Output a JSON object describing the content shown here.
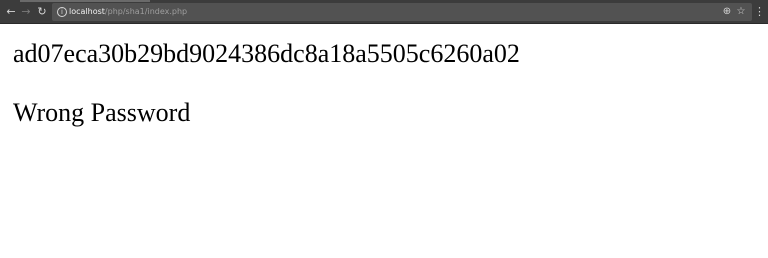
{
  "browser": {
    "icons": {
      "back": "arrow-left-icon",
      "forward": "arrow-right-icon",
      "reload": "reload-icon",
      "info": "info-icon",
      "zoom": "zoom-icon",
      "bookmark": "star-icon",
      "menu": "kebab-menu-icon"
    },
    "address_bar": {
      "host": "localhost",
      "path": "/php/sha1/index.php"
    }
  },
  "page": {
    "hash": "ad07eca30b29bd9024386dc8a18a5505c6260a02",
    "message": "Wrong Password"
  }
}
